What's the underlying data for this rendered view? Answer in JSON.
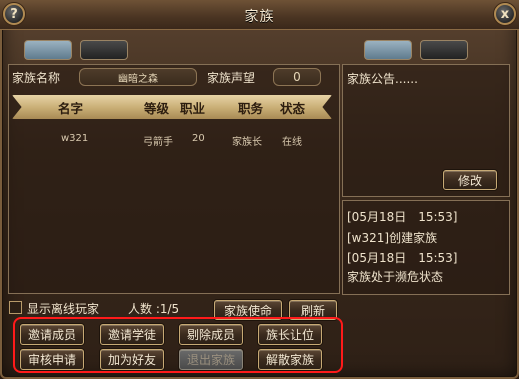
{
  "window": {
    "title": "家族",
    "help_label": "?",
    "close_label": "x"
  },
  "info": {
    "clan_name_label": "家族名称",
    "clan_name_value": "幽暗之森",
    "reputation_label": "家族声望",
    "reputation_value": "0"
  },
  "table": {
    "headers": [
      "名字",
      "等级",
      "职业",
      "职务",
      "状态"
    ],
    "rows": [
      {
        "name": "w321",
        "profession": "弓箭手",
        "level": "20",
        "position": "家族长",
        "status": "在线"
      }
    ]
  },
  "notice": {
    "title": "家族公告......",
    "edit_label": "修改"
  },
  "log": [
    "[05月18日　15:53]",
    "[w321]创建家族",
    "[05月18日　15:53]",
    "家族处于濒危状态"
  ],
  "footer": {
    "show_offline_label": "显示离线玩家",
    "population_label": "人数 :1/5",
    "clan_mission_label": "家族使命",
    "refresh_label": "刷新"
  },
  "actions": {
    "invite_member": "邀请成员",
    "invite_apprentice": "邀请学徒",
    "remove_member": "剔除成员",
    "transfer_leader": "族长让位",
    "review_applications": "审核申请",
    "add_friend": "加为好友",
    "leave_clan": "退出家族",
    "disband_clan": "解散家族"
  },
  "colors": {
    "highlight": "#ff1a1a",
    "header_gold": "#c8ad74",
    "frame_brown": "#3b2a1c"
  }
}
